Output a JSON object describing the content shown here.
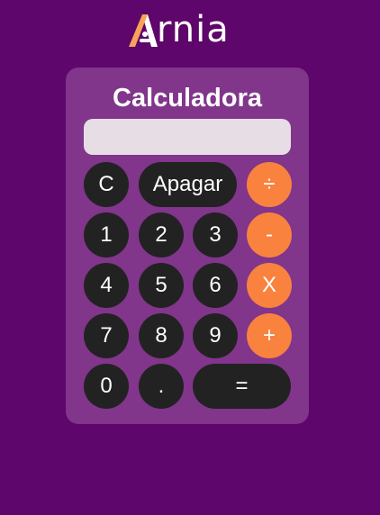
{
  "brand": {
    "logo_text": "rnia",
    "logo_letter": "A"
  },
  "title": "Calculadora",
  "display": {
    "value": ""
  },
  "buttons": {
    "clear": "C",
    "erase": "Apagar",
    "divide": "÷",
    "one": "1",
    "two": "2",
    "three": "3",
    "minus": "-",
    "four": "4",
    "five": "5",
    "six": "6",
    "multiply": "X",
    "seven": "7",
    "eight": "8",
    "nine": "9",
    "plus": "+",
    "zero": "0",
    "dot": ".",
    "equals": "="
  },
  "colors": {
    "background": "#5e066b",
    "card": "#81358b",
    "number_button": "#222222",
    "operator_button": "#f9823f",
    "display": "#e7dde5"
  }
}
